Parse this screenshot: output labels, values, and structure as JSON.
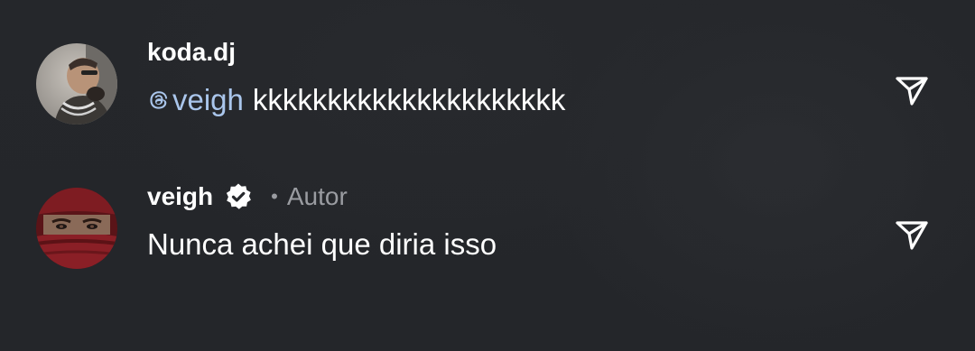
{
  "comments": [
    {
      "username": "koda.dj",
      "mention": "veigh",
      "text": "kkkkkkkkkkkkkkkkkkkkk",
      "verified": false,
      "author_label": "",
      "avatar_icon": "avatar-photo-koda",
      "share_icon": "send-icon"
    },
    {
      "username": "veigh",
      "mention": "",
      "text": "Nunca achei que diria isso",
      "verified": true,
      "dot": "•",
      "author_label": "Autor",
      "avatar_icon": "avatar-photo-veigh",
      "share_icon": "send-icon"
    }
  ],
  "colors": {
    "background": "#26282c",
    "mention": "#aac6ec",
    "secondary_text": "#9a9ca1",
    "primary_text": "#ffffff"
  }
}
